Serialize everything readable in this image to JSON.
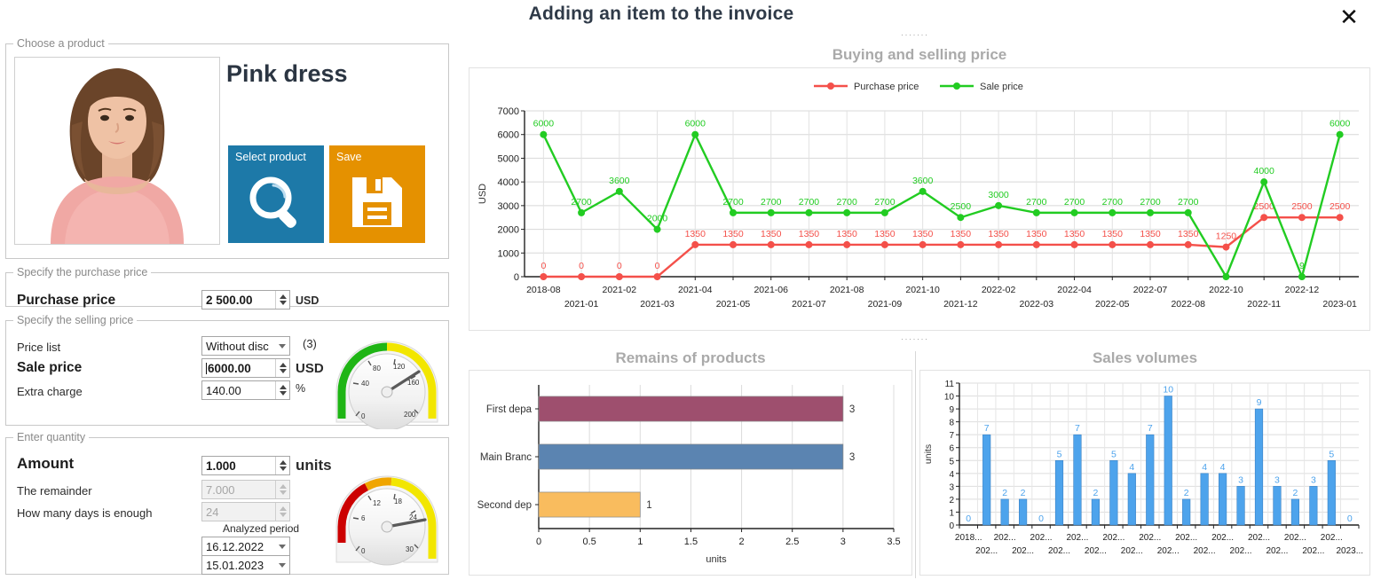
{
  "header": {
    "title": "Adding an item to the invoice",
    "close_label": "✕"
  },
  "product_group": {
    "legend": "Choose a product",
    "product_name": "Pink dress",
    "select_button": "Select product",
    "save_button": "Save"
  },
  "purchase_group": {
    "legend": "Specify the purchase price",
    "label": "Purchase price",
    "value": "2 500.00",
    "unit": "USD"
  },
  "selling_group": {
    "legend": "Specify the selling price",
    "price_list_label": "Price list",
    "price_list_value": "Without disc",
    "price_list_count": "(3)",
    "sale_price_label": "Sale price",
    "sale_price_value": "6000.00",
    "sale_price_unit": "USD",
    "extra_charge_label": "Extra charge",
    "extra_charge_value": "140.00",
    "extra_charge_unit": "%",
    "gauge": {
      "min": 0,
      "max": 200,
      "value": 140,
      "ticks": [
        "0",
        "40",
        "80",
        "120",
        "160",
        "200"
      ],
      "band_colors": [
        "#1fb515",
        "#f2e600"
      ]
    }
  },
  "quantity_group": {
    "legend": "Enter quantity",
    "amount_label": "Amount",
    "amount_value": "1.000",
    "amount_unit": "units",
    "remainder_label": "The remainder",
    "remainder_value": "7.000",
    "days_label": "How many days is enough",
    "days_value": "24",
    "period_label": "Analyzed period",
    "date_from": "16.12.2022",
    "date_to": "15.01.2023",
    "gauge": {
      "min": 0,
      "max": 30,
      "value": 24,
      "ticks": [
        "0",
        "6",
        "12",
        "18",
        "24",
        "30"
      ],
      "band_colors": [
        "#cc0000",
        "#f0a500",
        "#f2e600"
      ]
    }
  },
  "chart_data": [
    {
      "type": "line",
      "title": "Buying and selling price",
      "xlabel": "",
      "ylabel": "USD",
      "ylim": [
        0,
        7000
      ],
      "yticks": [
        0,
        1000,
        2000,
        3000,
        4000,
        5000,
        6000,
        7000
      ],
      "grid": true,
      "legend_position": "top",
      "categories": [
        "2018-08",
        "2021-01",
        "2021-02",
        "2021-03",
        "2021-04",
        "2021-05",
        "2021-06",
        "2021-07",
        "2021-08",
        "2021-09",
        "2021-10",
        "2021-12",
        "2022-02",
        "2022-03",
        "2022-04",
        "2022-05",
        "2022-07",
        "2022-08",
        "2022-10",
        "2022-11",
        "2022-12",
        "2023-01"
      ],
      "series": [
        {
          "name": "Purchase price",
          "color": "#f4504a",
          "values": [
            0,
            0,
            0,
            0,
            1350,
            1350,
            1350,
            1350,
            1350,
            1350,
            1350,
            1350,
            1350,
            1350,
            1350,
            1350,
            1350,
            1350,
            1250,
            2500,
            2500,
            2500
          ],
          "labels": [
            "0",
            "0",
            "0",
            "0",
            "1350",
            "1350",
            "1350",
            "1350",
            "1350",
            "1350",
            "1350",
            "1350",
            "1350",
            "1350",
            "1350",
            "1350",
            "1350",
            "1350",
            "1250",
            "2500",
            "2500",
            "2500"
          ]
        },
        {
          "name": "Sale price",
          "color": "#22cc22",
          "values": [
            6000,
            2700,
            3600,
            2000,
            6000,
            2700,
            2700,
            2700,
            2700,
            2700,
            3600,
            2500,
            3000,
            2700,
            2700,
            2700,
            2700,
            2700,
            0,
            4000,
            0,
            6000
          ],
          "labels": [
            "6000",
            "2700",
            "3600",
            "2000",
            "6000",
            "2700",
            "2700",
            "2700",
            "2700",
            "2700",
            "3600",
            "2500",
            "3000",
            "2700",
            "2700",
            "2700",
            "2700",
            "2700",
            "",
            "4000",
            "9",
            "6000"
          ]
        }
      ]
    },
    {
      "type": "bar",
      "orientation": "horizontal",
      "title": "Remains of products",
      "xlabel": "units",
      "ylabel": "",
      "xlim": [
        0,
        3.5
      ],
      "xticks": [
        "0",
        "0.5",
        "1",
        "1.5",
        "2",
        "2.5",
        "3",
        "3.5"
      ],
      "grid": true,
      "categories": [
        "First depa",
        "Main Branc",
        "Second dep"
      ],
      "values": [
        3,
        3,
        1
      ],
      "value_labels": [
        "3",
        "3",
        "1"
      ],
      "bar_colors": [
        "#9e4f6e",
        "#5b84b1",
        "#f9bc5e"
      ]
    },
    {
      "type": "bar",
      "orientation": "vertical",
      "title": "Sales volumes",
      "xlabel": "",
      "ylabel": "units",
      "ylim": [
        0,
        11
      ],
      "yticks": [
        0,
        1,
        2,
        3,
        4,
        5,
        6,
        7,
        8,
        9,
        10,
        11
      ],
      "grid": true,
      "bar_color": "#4da3ec",
      "categories": [
        "2018...",
        "202...",
        "202...",
        "202...",
        "202...",
        "202...",
        "202...",
        "202...",
        "202...",
        "202...",
        "202...",
        "202...",
        "202...",
        "202...",
        "202...",
        "202...",
        "202...",
        "202...",
        "202...",
        "202...",
        "202...",
        "2023..."
      ],
      "values": [
        0,
        7,
        2,
        2,
        0,
        5,
        7,
        2,
        5,
        4,
        7,
        10,
        2,
        4,
        4,
        3,
        9,
        3,
        2,
        3,
        5,
        0
      ],
      "value_labels": [
        "0",
        "7",
        "2",
        "2",
        "0",
        "5",
        "7",
        "2",
        "5",
        "4",
        "7",
        "10",
        "2",
        "4",
        "4",
        "3",
        "9",
        "3",
        "2",
        "3",
        "5",
        "0"
      ]
    }
  ]
}
